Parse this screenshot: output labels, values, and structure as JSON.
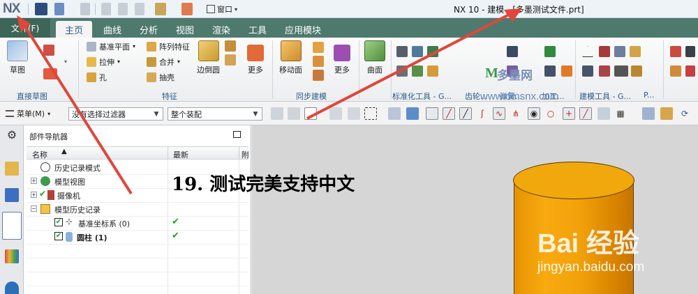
{
  "titlebar": {
    "logo": "NX",
    "window_menu": "窗口",
    "title": "NX 10 - 建模 - [多墨测试文件.prt]"
  },
  "menu": {
    "file": "文件(F)",
    "tabs": [
      "主页",
      "曲线",
      "分析",
      "视图",
      "渲染",
      "工具",
      "应用模块"
    ]
  },
  "ribbon": {
    "sketch": "草图",
    "datum_plane": "基准平面",
    "pattern_feature": "阵列特征",
    "extrude": "拉伸",
    "unite": "合并",
    "hole": "孔",
    "shell": "抽壳",
    "edge_blend": "边倒圆",
    "more": "更多",
    "move_face": "移动面",
    "surface": "曲面",
    "groups": {
      "direct_sketch": "直接草图",
      "feature": "特征",
      "sync_modeling": "同步建模",
      "standard_tools": "标准化工具 - G...",
      "gear": "齿轮...",
      "spring": "弹簧...",
      "machining": "加工...",
      "build_tools": "建模工具 - G...",
      "p": "P..."
    }
  },
  "selection_bar": {
    "menu_label": "菜单(M)",
    "filter": "没有选择过滤器",
    "scope": "整个装配"
  },
  "navigator": {
    "title": "部件导航器",
    "col_name": "名称",
    "col_latest": "最新",
    "col_extra": "附",
    "rows": [
      {
        "label": "历史记录模式",
        "check": ""
      },
      {
        "label": "模型视图",
        "check": ""
      },
      {
        "label": "摄像机",
        "check": ""
      },
      {
        "label": "模型历史记录",
        "check": ""
      },
      {
        "label": "基准坐标系 (0)",
        "check": "✔"
      },
      {
        "label": "圆柱 (1)",
        "check": "✔"
      }
    ]
  },
  "viewport": {
    "caption": "19. 测试完美支持中文"
  },
  "watermarks": {
    "site_m": "M",
    "site_name": "多墨网",
    "site_url": "www.dmsnx.com",
    "baidu": "Bai 经验",
    "baidu_url": "jingyan.baidu.com"
  },
  "colors": {
    "tab_bar": "#4e7a6e",
    "accent_blue": "#2a5c8a",
    "cylinder": "#f2a10a",
    "arrow": "#e0463c",
    "check_green": "#1e9e2a"
  }
}
